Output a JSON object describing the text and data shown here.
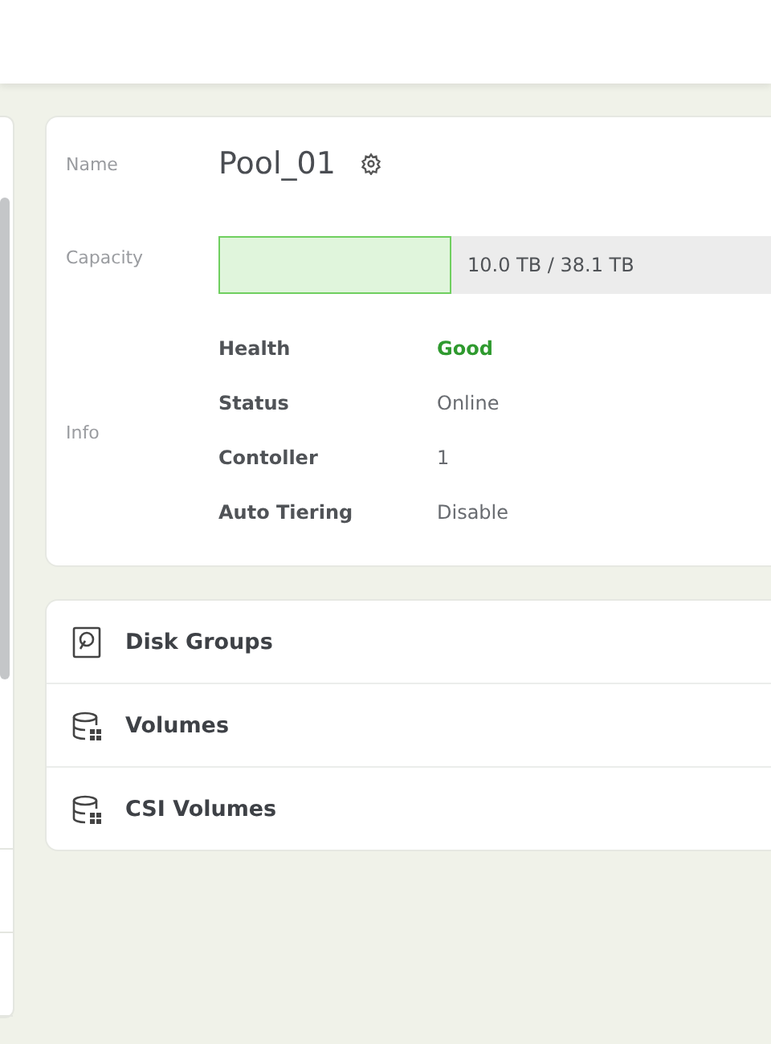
{
  "pool": {
    "name_label": "Name",
    "name": "Pool_01",
    "capacity_label": "Capacity",
    "capacity": {
      "level": 0.262,
      "text": "10.0 TB / 38.1 TB"
    },
    "info_label": "Info",
    "info": [
      {
        "label": "Health",
        "value": "Good",
        "kind": "health"
      },
      {
        "label": "Status",
        "value": "Online",
        "kind": "plain"
      },
      {
        "label": "Contoller",
        "value": "1",
        "kind": "plain"
      },
      {
        "label": "Auto Tiering",
        "value": "Disable",
        "kind": "plain"
      }
    ]
  },
  "sections": [
    {
      "label": "Disk Groups",
      "kind": "disk"
    },
    {
      "label": "Volumes",
      "kind": "volume"
    },
    {
      "label": "CSI Volumes",
      "kind": "volume"
    }
  ]
}
